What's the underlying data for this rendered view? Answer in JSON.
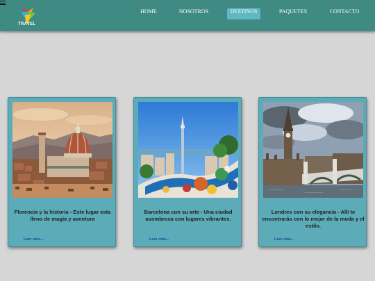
{
  "brand": {
    "name": "TRAVEL"
  },
  "nav": {
    "items": [
      {
        "label": "HOME"
      },
      {
        "label": "NOSOTROS"
      },
      {
        "label": "DESTINOS"
      },
      {
        "label": "PAQUETES"
      },
      {
        "label": "CONTACTO"
      }
    ],
    "active": "DESTINOS"
  },
  "cards": [
    {
      "description": "Florencia y la historia - Este lugar esta lleno de magia y aventura",
      "link": "Leer más...",
      "image_icon": "florence-cathedral-image"
    },
    {
      "description": "Barcelona con su arte - Una ciudad asombrosa con lugares vibrantes.",
      "link": "Leer más...",
      "image_icon": "barcelona-park-guell-image"
    },
    {
      "description": "Londres con su elegancia - Allí te encontrarás con lo mejor de la moda y el estilo.",
      "link": "Leer más...",
      "image_icon": "london-big-ben-image"
    }
  ],
  "colors": {
    "navbar": "#3f8a83",
    "active_tab": "#5fb7c2",
    "card": "#5cabb8",
    "background": "#d6d6d6",
    "link": "#1f4a9a"
  }
}
